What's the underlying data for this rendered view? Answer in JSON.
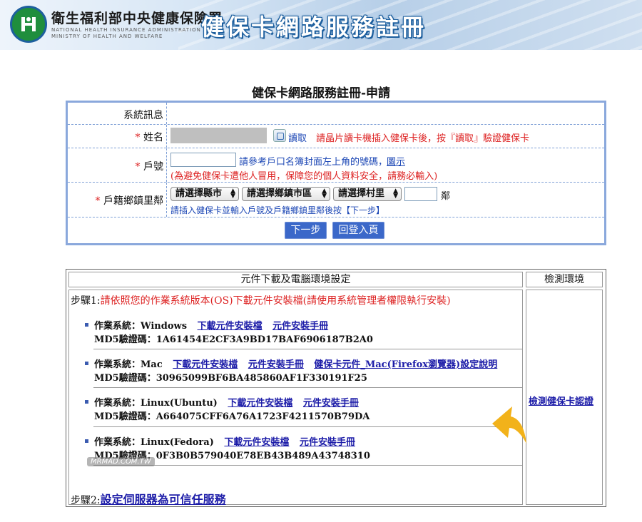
{
  "banner": {
    "org_name": "衛生福利部中央健康保險署",
    "org_en_line1": "NATIONAL HEALTH INSURANCE ADMINISTRATION",
    "org_en_line2": "MINISTRY OF HEALTH AND WELFARE",
    "title": "健保卡網路服務註冊"
  },
  "form": {
    "heading": "健保卡網路服務註冊-申請",
    "system_msg_label": "系統訊息",
    "required_mark": "*",
    "name_label": "姓名",
    "read_label": "讀取",
    "name_hint": "請晶片讀卡機插入健保卡後，按『讀取』驗證健保卡",
    "household_label": "戶號",
    "household_hint": "請參考戶口名簿封面左上角的號碼，",
    "household_example_link": "圖示",
    "household_warning": "(為避免健保卡遭他人冒用，保障您的個人資料安全，請務必輸入)",
    "address_label": "戶籍鄉鎮里鄰",
    "county_select": "請選擇縣市",
    "town_select": "請選擇鄉鎮市區",
    "village_select": "請選擇村里",
    "neighborhood_unit": "鄰",
    "address_hint": "請插入健保卡並輸入戶號及戶籍鄉鎮里鄰後按【下一步】",
    "next_button": "下一步",
    "back_button": "回登入頁"
  },
  "downloads": {
    "header_left": "元件下載及電腦環境設定",
    "header_right": "檢測環境",
    "step1_prefix": "步驟1:",
    "step1_text": "請依照您的作業系統版本(OS)下載元件安裝檔(請使用系統管理者權限執行安裝)",
    "os_items": [
      {
        "os": "作業系統：Windows",
        "links": [
          "下載元件安裝檔",
          "元件安裝手冊"
        ],
        "md5": "MD5驗證碼：1A61454E2CF3A9BD17BAF6906187B2A0"
      },
      {
        "os": "作業系統：Mac",
        "links": [
          "下載元件安裝檔",
          "元件安裝手冊",
          "健保卡元件_Mac(Firefox瀏覽器)設定說明"
        ],
        "md5": "MD5驗證碼：30965099BF6BA485860AF1F330191F25"
      },
      {
        "os": "作業系統：Linux(Ubuntu)",
        "links": [
          "下載元件安裝檔",
          "元件安裝手冊"
        ],
        "md5": "MD5驗證碼：A664075CFF6A76A1723F4211570B79DA"
      },
      {
        "os": "作業系統：Linux(Fedora)",
        "links": [
          "下載元件安裝檔",
          "元件安裝手冊"
        ],
        "md5": "MD5驗證碼：0F3B0B579040E78EB43B489A43748310"
      }
    ],
    "step2_prefix": "步驟2:",
    "step2_link": "設定伺服器為可信任服務",
    "check_link": "檢測健保卡認證"
  },
  "watermark": "MRMAD.COM.TW",
  "colors": {
    "accent_blue": "#3b68c9",
    "warning_red": "#dd2222",
    "link_blue": "#1c1ca8",
    "pointer_yellow": "#f2b21a"
  },
  "icons": {
    "read_button": "card-reader-icon",
    "pointer": "arrow-pointer-icon"
  }
}
